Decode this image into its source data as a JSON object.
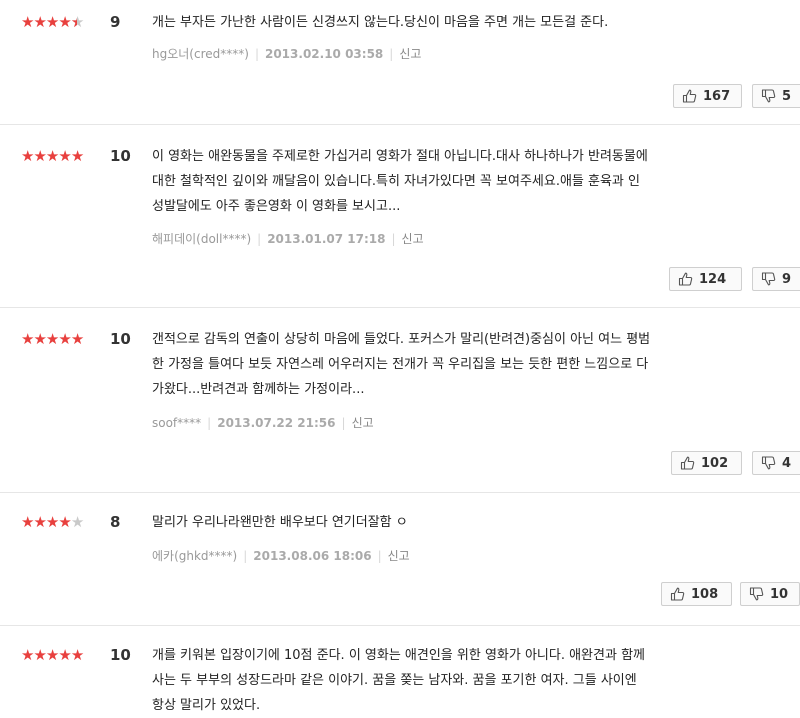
{
  "reviews": [
    {
      "rating": 9,
      "score_label": "9",
      "text": "개는 부자든 가난한 사람이든 신경쓰지 않는다.당신이 마음을 주면 개는 모든걸 준다.",
      "author": "hg오너(cred****)",
      "date": "2013.02.10 03:58",
      "report_label": "신고",
      "likes": "167",
      "dislikes": "5"
    },
    {
      "rating": 10,
      "score_label": "10",
      "text": "이 영화는 애완동물을 주제로한 가십거리 영화가 절대 아닙니다.대사 하나하나가 반려동물에\n대한 철학적인 깊이와 깨달음이 있습니다.특히 자녀가있다면 꼭 보여주세요.애들 훈육과 인\n성발달에도 아주 좋은영화 이 영화를 보시고...",
      "author": "해피데이(doll****)",
      "date": "2013.01.07 17:18",
      "report_label": "신고",
      "likes": "124",
      "dislikes": "9"
    },
    {
      "rating": 10,
      "score_label": "10",
      "text": "갠적으로 감독의 연출이 상당히 마음에 들었다. 포커스가 말리(반려견)중심이 아닌 여느 평범\n한 가정을 틀여다 보듯 자연스레 어우러지는 전개가 꼭 우리집을 보는 듯한 편한 느낌으로 다\n가왔다...반려견과 함께하는 가정이라...",
      "author": "soof****",
      "date": "2013.07.22 21:56",
      "report_label": "신고",
      "likes": "102",
      "dislikes": "4"
    },
    {
      "rating": 8,
      "score_label": "8",
      "text": "말리가 우리나라왠만한 배우보다 연기더잘함 ㅇ",
      "author": "에카(ghkd****)",
      "date": "2013.08.06 18:06",
      "report_label": "신고",
      "likes": "108",
      "dislikes": "10"
    },
    {
      "rating": 10,
      "score_label": "10",
      "text": "개를 키워본 입장이기에 10점 준다. 이 영화는 애견인을 위한 영화가 아니다. 애완견과 함께\n사는 두 부부의 성장드라마 같은 이야기. 꿈을 쫒는 남자와. 꿈을 포기한 여자. 그들 사이엔\n항상 말리가 있었다."
    }
  ],
  "colors": {
    "star_on": "#e8403e",
    "star_off": "#c9c9c9",
    "divider": "#e6e6e6"
  }
}
